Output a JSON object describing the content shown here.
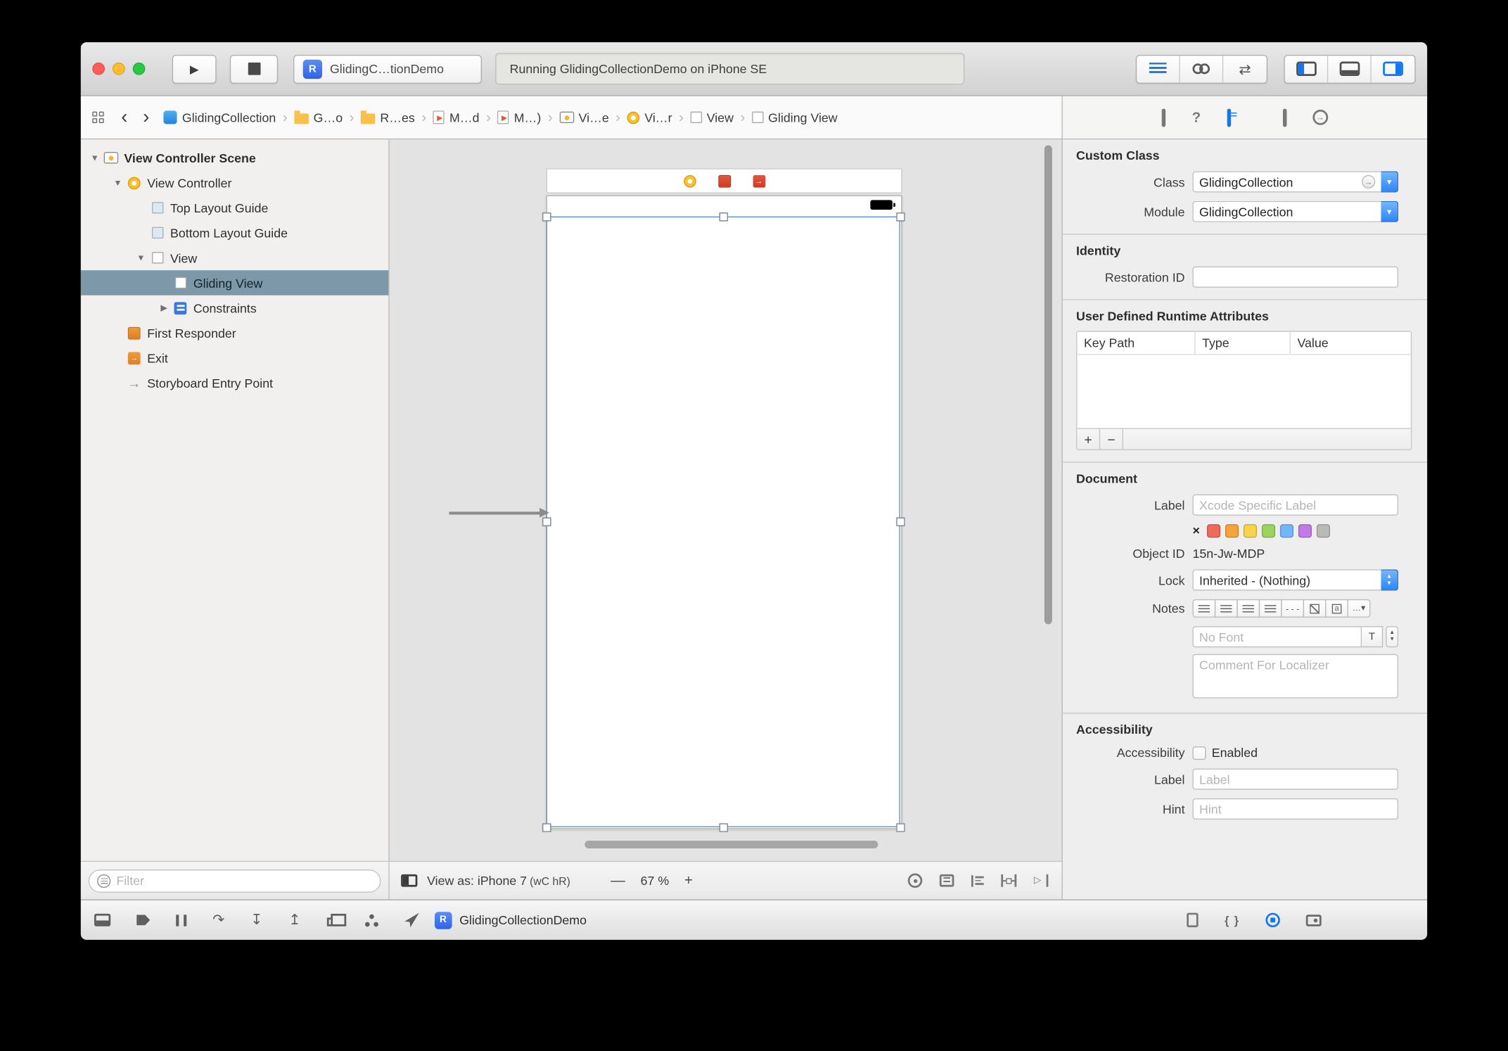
{
  "colors": {
    "traffic_red": "#ff5f57",
    "traffic_yellow": "#febc2e",
    "traffic_green": "#28c840",
    "accent_blue": "#1577f0",
    "selection_row": "#7d98a8",
    "label_colors": [
      "#ee6a5b",
      "#f5a43b",
      "#f7d44c",
      "#9ed360",
      "#74b7f8",
      "#c07ce4",
      "#b9b9b9"
    ]
  },
  "icons": {
    "play": "▶",
    "back": "‹",
    "forward": "›",
    "separator": "›",
    "disclosure_open": "▼",
    "disclosure_closed": "▶",
    "entry_arrow": "→",
    "exit_arrow": "→",
    "swap": "⇄",
    "question": "?",
    "braces": "{ }",
    "step_over": "↷",
    "step_into": "↧",
    "step_out": "↥",
    "none_x": "×",
    "plus": "+",
    "minus": "−",
    "zoom_out": "—",
    "zoom_in": "+",
    "dd_chevron": "▾",
    "popup_up": "▴",
    "popup_down": "▾",
    "stepper_up": "▲",
    "stepper_down": "▼",
    "ellipsis_menu": "…▾",
    "a_glyph": "a",
    "dashes": "- - -",
    "resolve_triangle": "▷"
  },
  "toolbar": {
    "scheme_chip": "R",
    "scheme": "GlidingC…tionDemo",
    "status": "Running GlidingCollectionDemo on iPhone SE"
  },
  "jumpbar": {
    "items": [
      {
        "label": "GlidingCollection"
      },
      {
        "label": "G…o"
      },
      {
        "label": "R…es"
      },
      {
        "label": "M…d"
      },
      {
        "label": "M…)"
      },
      {
        "label": "Vi…e"
      },
      {
        "label": "Vi…r"
      },
      {
        "label": "View"
      },
      {
        "label": "Gliding View"
      }
    ]
  },
  "outline": {
    "items": [
      {
        "label": "View Controller Scene",
        "depth": 0,
        "icon": "scene"
      },
      {
        "label": "View Controller",
        "depth": 1,
        "icon": "view-controller"
      },
      {
        "label": "Top Layout Guide",
        "depth": 2,
        "icon": "layout-guide"
      },
      {
        "label": "Bottom Layout Guide",
        "depth": 2,
        "icon": "layout-guide"
      },
      {
        "label": "View",
        "depth": 2,
        "icon": "view"
      },
      {
        "label": "Gliding View",
        "depth": 3,
        "icon": "view",
        "selected": true
      },
      {
        "label": "Constraints",
        "depth": 3,
        "icon": "constraints"
      },
      {
        "label": "First Responder",
        "depth": 1,
        "icon": "first-responder"
      },
      {
        "label": "Exit",
        "depth": 1,
        "icon": "exit"
      },
      {
        "label": "Storyboard Entry Point",
        "depth": 1,
        "icon": "entry-point"
      }
    ],
    "filter_placeholder": "Filter"
  },
  "canvas": {
    "view_as": "View as: iPhone 7",
    "trait": "(wC hR)",
    "zoom": "67 %"
  },
  "inspector": {
    "custom_class": {
      "title": "Custom Class",
      "class_label": "Class",
      "class_value": "GlidingCollection",
      "module_label": "Module",
      "module_value": "GlidingCollection"
    },
    "identity": {
      "title": "Identity",
      "restoration_label": "Restoration ID"
    },
    "runtime_attributes": {
      "title": "User Defined Runtime Attributes",
      "columns": [
        "Key Path",
        "Type",
        "Value"
      ]
    },
    "document": {
      "title": "Document",
      "label_label": "Label",
      "label_placeholder": "Xcode Specific Label",
      "object_id_label": "Object ID",
      "object_id": "15n-Jw-MDP",
      "lock_label": "Lock",
      "lock_value": "Inherited - (Nothing)",
      "notes_label": "Notes",
      "font_placeholder": "No Font",
      "font_button": "T",
      "localizer_placeholder": "Comment For Localizer"
    },
    "accessibility": {
      "title": "Accessibility",
      "accessibility_label": "Accessibility",
      "enabled_label": "Enabled",
      "label_label": "Label",
      "label_placeholder": "Label",
      "hint_label": "Hint",
      "hint_placeholder": "Hint"
    }
  },
  "debugbar": {
    "chip": "R",
    "process": "GlidingCollectionDemo"
  }
}
